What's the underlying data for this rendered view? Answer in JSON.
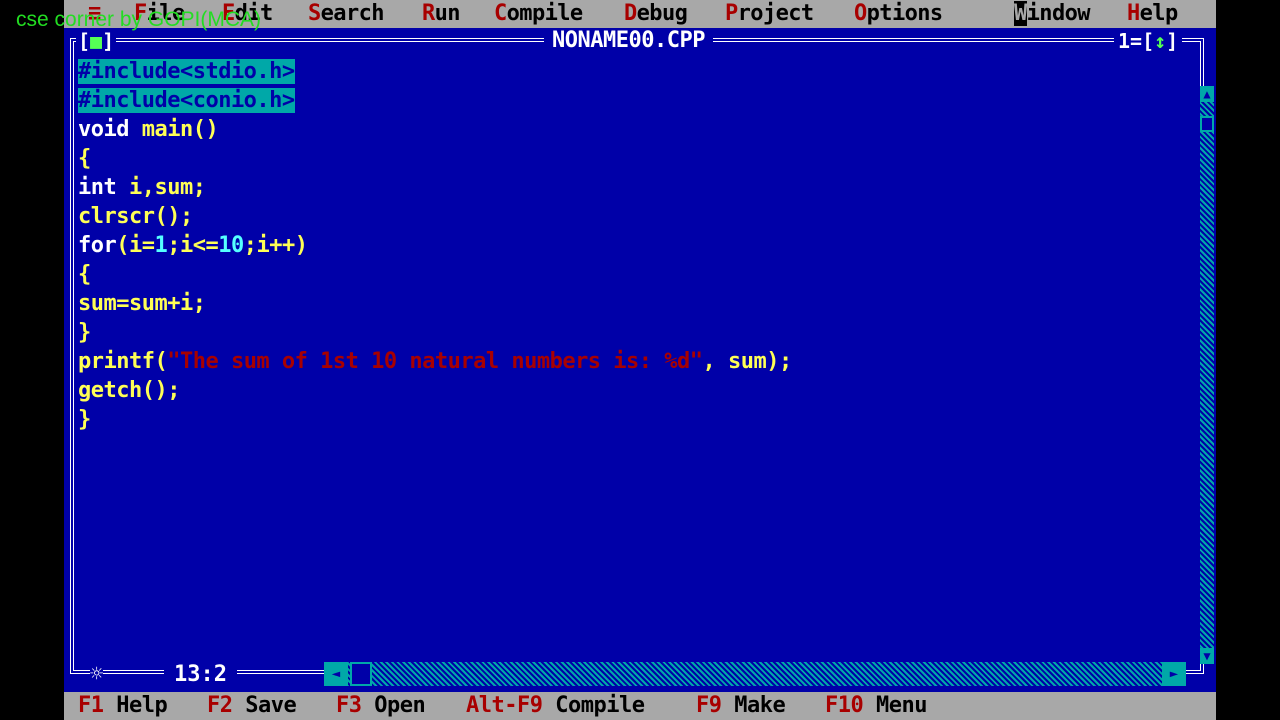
{
  "watermark": "cse corner by GOPI(MCA)",
  "menu": {
    "system": "≡",
    "items": [
      {
        "hotkey": "F",
        "rest": "ile"
      },
      {
        "hotkey": "E",
        "rest": "dit"
      },
      {
        "hotkey": "S",
        "rest": "earch"
      },
      {
        "hotkey": "R",
        "rest": "un"
      },
      {
        "hotkey": "C",
        "rest": "ompile"
      },
      {
        "hotkey": "D",
        "rest": "ebug"
      },
      {
        "hotkey": "P",
        "rest": "roject"
      },
      {
        "hotkey": "O",
        "rest": "ptions"
      },
      {
        "hotkey": "W",
        "rest": "indow"
      },
      {
        "hotkey": "H",
        "rest": "elp"
      }
    ]
  },
  "window": {
    "close_box": "[■]",
    "title": "NONAME00.CPP",
    "number": "1=[↕]"
  },
  "code": {
    "lines": [
      "#include<stdio.h>",
      "#include<conio.h>",
      "void main()",
      "{",
      "int i,sum;",
      "clrscr();",
      "for(i=1;i<=10;i++)",
      "{",
      "sum=sum+i;",
      "}",
      "printf(\"The sum of 1st 10 natural numbers is: %d\", sum);",
      "getch();",
      "}"
    ],
    "printf_parts": {
      "fn": "printf(",
      "str": "\"The sum of 1st 10 natural numbers is: %d\"",
      "tail": ", sum);"
    }
  },
  "status": {
    "modified_marker": "☼",
    "cursor_position": "13:2"
  },
  "fkeys": [
    {
      "key": "F1",
      "label": "Help"
    },
    {
      "key": "F2",
      "label": "Save"
    },
    {
      "key": "F3",
      "label": "Open"
    },
    {
      "key": "Alt-F9",
      "label": "Compile"
    },
    {
      "key": "F9",
      "label": "Make"
    },
    {
      "key": "F10",
      "label": "Menu"
    }
  ],
  "colors": {
    "background": "#0000a8",
    "menu_bar": "#a8a8a8",
    "hotkey": "#a80000",
    "selection": "#00a8a8"
  }
}
